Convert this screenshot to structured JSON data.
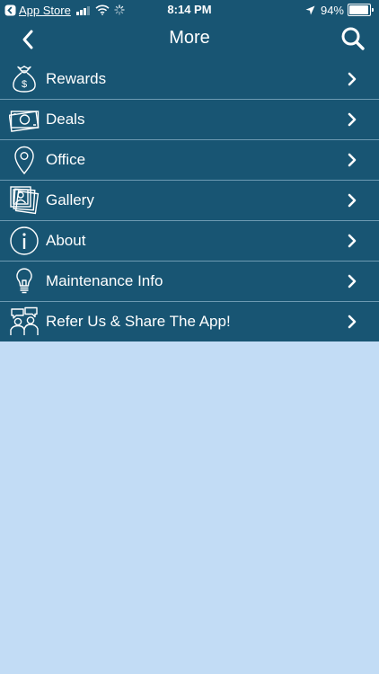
{
  "status_bar": {
    "back_app_label": "App Store",
    "time": "8:14 PM",
    "battery_percent": "94%",
    "battery_level": 0.94
  },
  "nav": {
    "title": "More"
  },
  "menu": {
    "items": [
      {
        "label": "Rewards",
        "icon": "money-bag-icon"
      },
      {
        "label": "Deals",
        "icon": "cash-icon"
      },
      {
        "label": "Office",
        "icon": "location-pin-icon"
      },
      {
        "label": "Gallery",
        "icon": "photos-icon"
      },
      {
        "label": "About",
        "icon": "info-icon"
      },
      {
        "label": "Maintenance Info",
        "icon": "lightbulb-icon"
      },
      {
        "label": "Refer Us & Share The App!",
        "icon": "people-chat-icon"
      }
    ]
  },
  "colors": {
    "header_bg": "#185573",
    "menu_bg": "#185573",
    "divider": "#6d9ab2",
    "page_bg": "#c2dcf5",
    "text": "#ffffff"
  }
}
